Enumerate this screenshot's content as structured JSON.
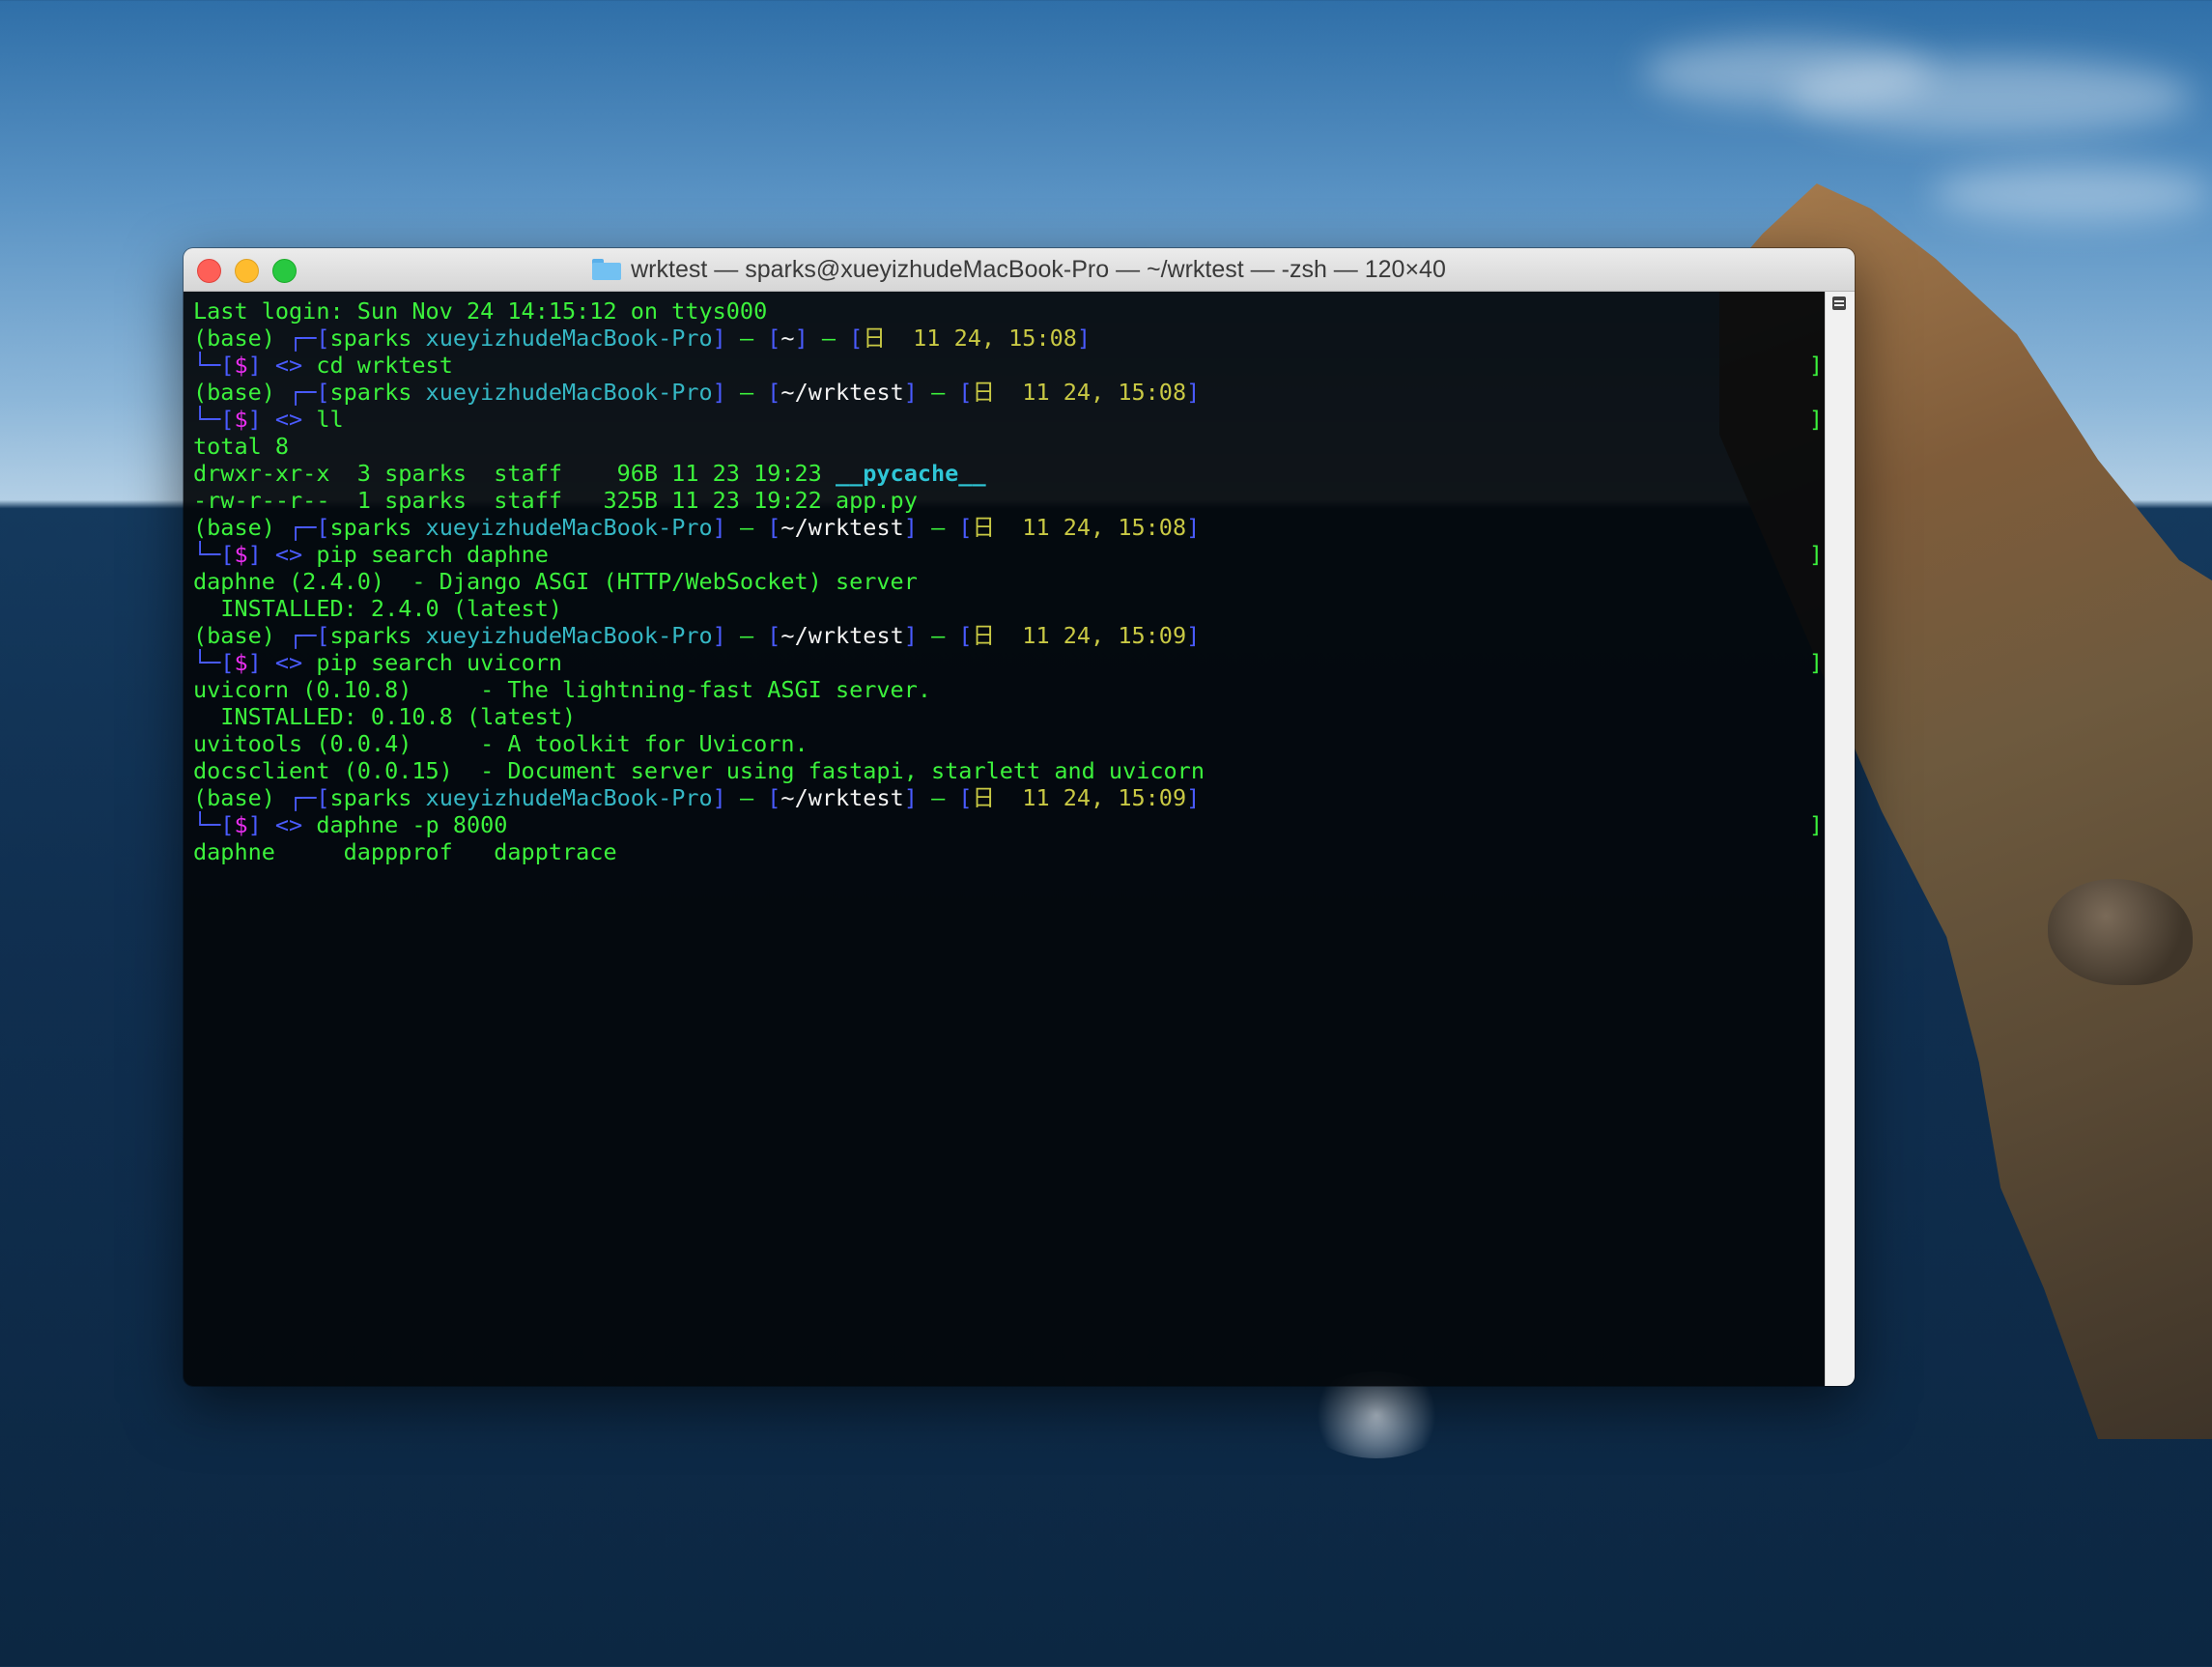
{
  "window": {
    "title": "wrktest — sparks@xueyizhudeMacBook-Pro — ~/wrktest — -zsh — 120×40"
  },
  "terminal": {
    "last_login": "Last login: Sun Nov 24 14:15:12 on ttys000",
    "prompt": {
      "env": "(base) ",
      "corner_top": "┌─[",
      "user": "sparks",
      "host": "xueyizhudeMacBook-Pro",
      "sep": "] – [",
      "date_prefix": "日  ",
      "corner_bottom": "└─[",
      "dollar": "$",
      "arrows": "<>"
    },
    "blocks": [
      {
        "path": "~",
        "time": "11 24, 15:08",
        "command": "cd wrktest",
        "output": []
      },
      {
        "path": "~/wrktest",
        "time": "11 24, 15:08",
        "command": "ll",
        "output": [
          "total 8",
          "drwxr-xr-x  3 sparks  staff    96B 11 23 19:23 ",
          "-rw-r--r--  1 sparks  staff   325B 11 23 19:22 app.py"
        ],
        "dir_name": "__pycache__"
      },
      {
        "path": "~/wrktest",
        "time": "11 24, 15:08",
        "command": "pip search daphne",
        "output": [
          "daphne (2.4.0)  - Django ASGI (HTTP/WebSocket) server",
          "  INSTALLED: 2.4.0 (latest)"
        ]
      },
      {
        "path": "~/wrktest",
        "time": "11 24, 15:09",
        "command": "pip search uvicorn",
        "output": [
          "uvicorn (0.10.8)     - The lightning-fast ASGI server.",
          "  INSTALLED: 0.10.8 (latest)",
          "uvitools (0.0.4)     - A toolkit for Uvicorn.",
          "docsclient (0.0.15)  - Document server using fastapi, starlett and uvicorn"
        ]
      },
      {
        "path": "~/wrktest",
        "time": "11 24, 15:09",
        "command": "daphne -p 8000",
        "output": [
          "daphne     dappprof   dapptrace"
        ]
      }
    ]
  }
}
